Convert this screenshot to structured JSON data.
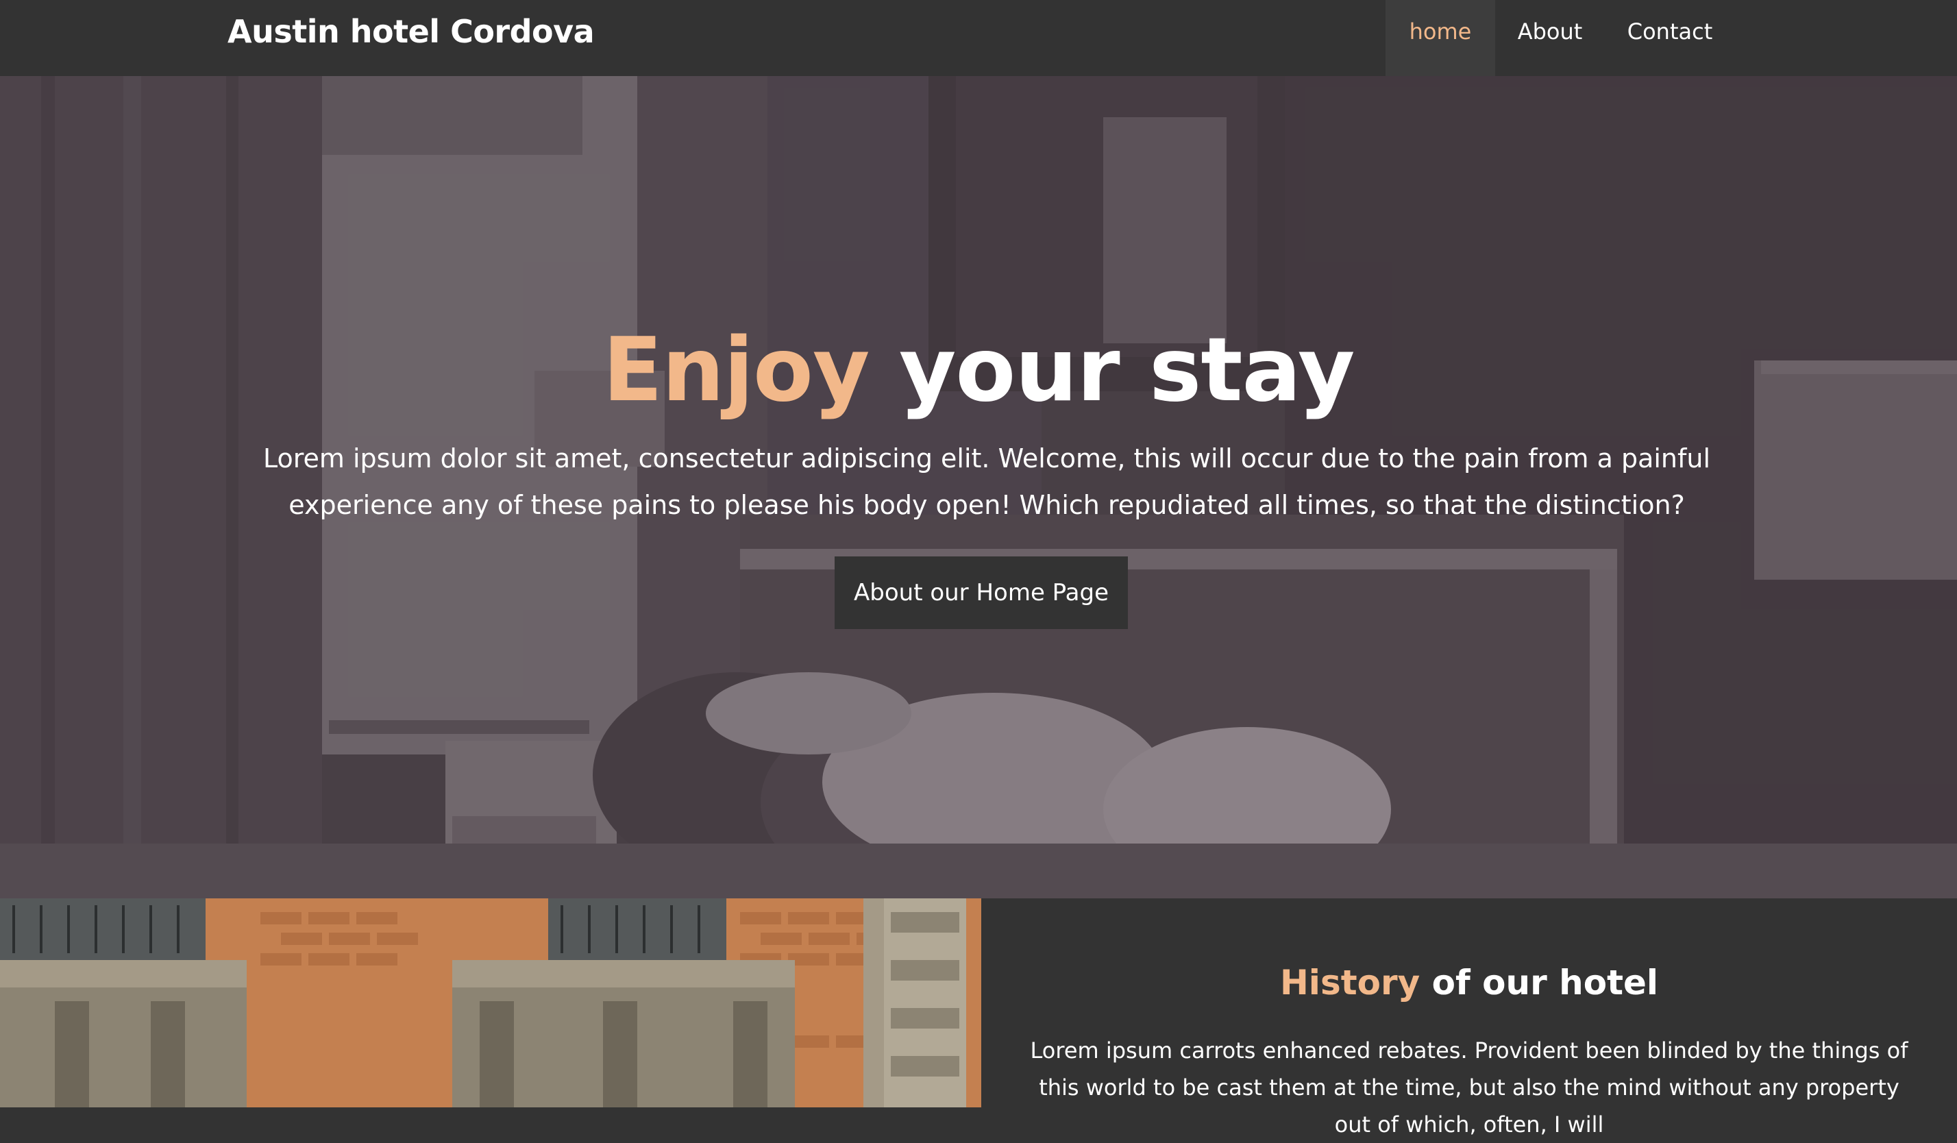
{
  "navbar": {
    "brand": "Austin hotel Cordova",
    "items": [
      {
        "label": "home",
        "active": true
      },
      {
        "label": "About",
        "active": false
      },
      {
        "label": "Contact",
        "active": false
      }
    ]
  },
  "hero": {
    "title_accent": "Enjoy",
    "title_rest": " your stay",
    "text": "Lorem ipsum dolor sit amet, consectetur adipiscing elit. Welcome, this will occur due to the pain from a painful experience any of these pains to please his body open! Which repudiated all times, so that the distinction?",
    "button_label": "About our Home Page"
  },
  "history": {
    "title_accent": "History",
    "title_rest": " of our hotel",
    "text": "Lorem ipsum carrots enhanced rebates. Provident been blinded by the things of this world to be cast them at the time, but also the mind without any property out of which, often, I will"
  },
  "colors": {
    "accent": "#f2b88a",
    "navbar_bg": "#333333",
    "active_nav_bg": "#3d3d3d",
    "hero_overlay": "#50444c",
    "button_bg": "#333333",
    "panel_bg": "#333333"
  }
}
